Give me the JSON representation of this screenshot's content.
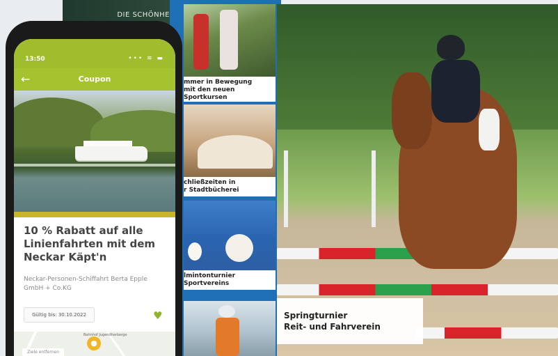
{
  "magazine": {
    "strip_text": "DIE SCHÖNHE"
  },
  "phone": {
    "status_time": "13:50",
    "status_icons": "••• ≋ ▬",
    "app_title": "Coupon",
    "back_icon": "arrow-left-icon",
    "coupon_title": "10 % Rabatt auf alle Linienfahrten mit dem Neckar Käpt'n",
    "company": "Neckar-Personen-Schiffahrt Berta Epple GmbH + Co.KG",
    "validity": "Gültig bis: 30.10.2022",
    "map_chip": "Ziele entfernen",
    "map_label": "Bahnhof Jugendherberge"
  },
  "cards": [
    {
      "caption_line1": "mmer in Bewegung",
      "caption_line2": "mit den neuen Sportkursen"
    },
    {
      "caption_line1": "chließzeiten in",
      "caption_line2": "r Stadtbücherei"
    },
    {
      "caption_line1": "lmintonturnier",
      "caption_line2": "Sportvereins"
    },
    {
      "caption_line1": "",
      "caption_line2": ""
    }
  ],
  "feature": {
    "line1": "Springturnier",
    "line2": "Reit- und Fahrverein"
  },
  "colors": {
    "brand_green": "#a5c22f",
    "magazine_blue": "#1e6fb6"
  }
}
